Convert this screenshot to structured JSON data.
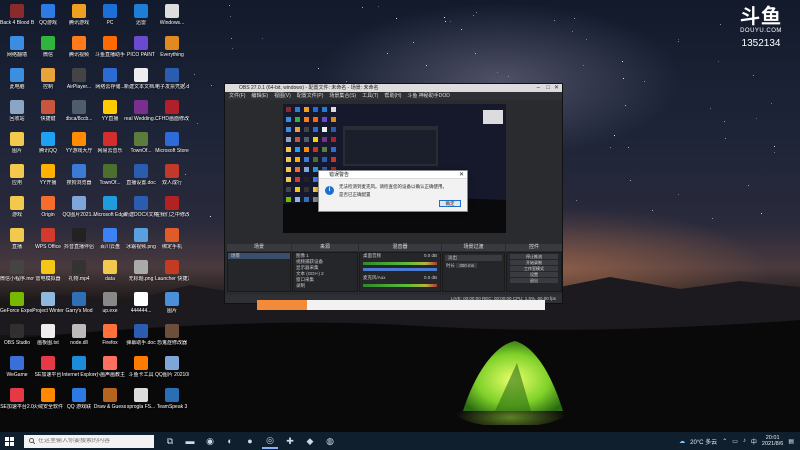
{
  "watermark": {
    "logo": "斗鱼",
    "site": "DOUYU.COM",
    "room_id": "1352134"
  },
  "desktop_icons": [
    {
      "label": "Back 4 Blood Beta",
      "color": "#8b2a2a"
    },
    {
      "label": "QQ游戏",
      "color": "#2c7be5"
    },
    {
      "label": "腾讯游戏",
      "color": "#f0a020"
    },
    {
      "label": "PC",
      "color": "#1a6fd8"
    },
    {
      "label": "迅雷",
      "color": "#1c7ed6"
    },
    {
      "label": "Windows...",
      "color": "#dddddd"
    },
    {
      "label": "网络翻墙",
      "color": "#3a8de0"
    },
    {
      "label": "微信",
      "color": "#2fb53c"
    },
    {
      "label": "腾讯视频",
      "color": "#ff7a1a"
    },
    {
      "label": "斗鱼直播助手",
      "color": "#ff6a00"
    },
    {
      "label": "PICO PAINT",
      "color": "#6a4ad1"
    },
    {
      "label": "Everything",
      "color": "#e08a20"
    },
    {
      "label": "此电脑",
      "color": "#3b8fe0"
    },
    {
      "label": "控制",
      "color": "#e8a43a"
    },
    {
      "label": "AirPlayer...",
      "color": "#444444"
    },
    {
      "label": "网络云存储...",
      "color": "#2b6cd4"
    },
    {
      "label": "新建文本文档.txt",
      "color": "#eeeeee"
    },
    {
      "label": "电子发票凭据.doc",
      "color": "#2a5db0"
    },
    {
      "label": "回收站",
      "color": "#8aa6c4"
    },
    {
      "label": "快捷键",
      "color": "#c8553d"
    },
    {
      "label": "dbca/8ccb...",
      "color": "#4e5d6c"
    },
    {
      "label": "YY直播",
      "color": "#ffcc00"
    },
    {
      "label": "real Wedding...",
      "color": "#7a2f8f"
    },
    {
      "label": "CFHD画面修改",
      "color": "#b0202a"
    },
    {
      "label": "图片",
      "color": "#f2c94c"
    },
    {
      "label": "腾讯QQ",
      "color": "#1da1f2"
    },
    {
      "label": "YY游戏大厅",
      "color": "#ff8c00"
    },
    {
      "label": "网易云音乐",
      "color": "#d42d2d"
    },
    {
      "label": "TownOf...",
      "color": "#5b7c3a"
    },
    {
      "label": "Microsoft Store",
      "color": "#2f6bd8"
    },
    {
      "label": "应用",
      "color": "#f2c94c"
    },
    {
      "label": "YY开播",
      "color": "#ffb000"
    },
    {
      "label": "搜狗浏览器",
      "color": "#3a7bd5"
    },
    {
      "label": "TownOf...",
      "color": "#4c6f2d"
    },
    {
      "label": "直播设置.doc",
      "color": "#2a5db0"
    },
    {
      "label": "双人成行",
      "color": "#c0392b"
    },
    {
      "label": "游戏",
      "color": "#f2c94c"
    },
    {
      "label": "Origin",
      "color": "#f56c2d"
    },
    {
      "label": "QQ图片2021...",
      "color": "#7fa6d9"
    },
    {
      "label": "Microsoft Edge",
      "color": "#1f9cde"
    },
    {
      "label": "新建DOCX文档.docx",
      "color": "#2a5db0"
    },
    {
      "label": "在我们之中修改器",
      "color": "#b22222"
    },
    {
      "label": "直播",
      "color": "#f2c94c"
    },
    {
      "label": "WPS Office",
      "color": "#d33a2c"
    },
    {
      "label": "抖音直播伴侣",
      "color": "#222222"
    },
    {
      "label": "百川云盘",
      "color": "#3b82f6"
    },
    {
      "label": "冰霜视频.png",
      "color": "#5aa0e0"
    },
    {
      "label": "绑定手机",
      "color": "#e05a2a"
    },
    {
      "label": "微信小程序.mov",
      "color": "#444444"
    },
    {
      "label": "雷电模拟器",
      "color": "#f5c518"
    },
    {
      "label": "礼物.mp4",
      "color": "#333333"
    },
    {
      "label": "data",
      "color": "#f2c94c"
    },
    {
      "label": "无标题.png",
      "color": "#aaaaaa"
    },
    {
      "label": "Launcher 快捷方式",
      "color": "#c23b22"
    },
    {
      "label": "GeForce Experience",
      "color": "#76b900"
    },
    {
      "label": "Project Winter",
      "color": "#8fb8de"
    },
    {
      "label": "Garry's Mod",
      "color": "#2f6fb5"
    },
    {
      "label": "up.exe",
      "color": "#888888"
    },
    {
      "label": "444444...",
      "color": "#ffffff"
    },
    {
      "label": "图片",
      "color": "#4a90d9"
    },
    {
      "label": "OBS Studio",
      "color": "#303030"
    },
    {
      "label": "画板图.txt",
      "color": "#eeeeee"
    },
    {
      "label": "node.dll",
      "color": "#bbbbbb"
    },
    {
      "label": "Firefox",
      "color": "#ff7139"
    },
    {
      "label": "弹幕助手.doc",
      "color": "#2a5db0"
    },
    {
      "label": "恐鬼症修改器",
      "color": "#6b4f3a"
    },
    {
      "label": "WeGame",
      "color": "#3a6fd8"
    },
    {
      "label": "SE加速平台",
      "color": "#e63946"
    },
    {
      "label": "Internet Explorer",
      "color": "#1c8cd8"
    },
    {
      "label": "小画声画教主",
      "color": "#ff6f61"
    },
    {
      "label": "斗鱼卡工具",
      "color": "#ff7b00"
    },
    {
      "label": "QQ图片 20210811...",
      "color": "#7fa6d9"
    },
    {
      "label": "SE加速平台2.0",
      "color": "#e63946"
    },
    {
      "label": "火绒安全软件",
      "color": "#ff8800"
    },
    {
      "label": "QQ 游戏联",
      "color": "#2c7be5"
    },
    {
      "label": "Draw & Guess",
      "color": "#b5651d"
    },
    {
      "label": "sprogla FS...",
      "color": "#dddddd"
    },
    {
      "label": "TeamSpeak 3",
      "color": "#2a6fb4"
    }
  ],
  "obs": {
    "title": "OBS 27.0.1 (64-bit, windows) - 配置文件: 未命名 - 场景: 未命名",
    "menu": [
      "文件(F)",
      "编辑(E)",
      "视图(V)",
      "配置文件(P)",
      "场景集合(S)",
      "工具(T)",
      "帮助(H)",
      "斗鱼 神秘助手DOD"
    ],
    "panels": {
      "scenes": "场景",
      "sources": "来源",
      "mixer": "混音器",
      "transitions": "场景过渡",
      "controls": "控件"
    },
    "scene_items": [
      "场景"
    ],
    "source_items": [
      "图像 1",
      "视频捕获设备",
      "显示器采集",
      "文本 (GDI+) 2",
      "窗口采集",
      "录制"
    ],
    "mixer_items": [
      "桌面音频",
      "麦克风/Aux"
    ],
    "mixer_level": "0.0 dB",
    "transition": {
      "type": "淡出",
      "duration_label": "时长",
      "duration": "300 ms"
    },
    "control_buttons": [
      "停止推流",
      "开始录制",
      "工作室模式",
      "设置",
      "退出"
    ],
    "status": "LIVE: 00:00:00   REC: 00:00:00   CPU: 1.5%, 60.00 fps"
  },
  "dialog": {
    "title": "错误警告",
    "message": "无法检测到麦克风。请检查您的设备以确认正确使用。",
    "sub": "是否已正确配置",
    "ok_label": "确定"
  },
  "taskbar": {
    "search_placeholder": "在这里输入你要搜索的内容",
    "pinned": [
      "task-view-icon",
      "file-explorer-icon",
      "steam-icon",
      "browser-icon",
      "firefox-icon",
      "obs-icon",
      "gamepad-icon",
      "douyu-icon",
      "chrome-icon"
    ],
    "weather": "20°C 多云",
    "time": "20:01",
    "date": "2021/8/6"
  }
}
